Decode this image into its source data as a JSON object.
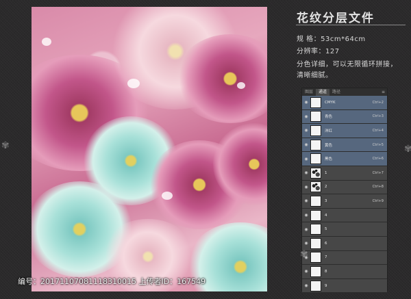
{
  "title": "花纹分层文件",
  "specs": {
    "size": "规 格：53cm*64cm",
    "resolution": "分辨率：127",
    "desc_line1": "分色详细，可以无限循环拼接，",
    "desc_line2": "清晰细腻。"
  },
  "channels_panel": {
    "tabs": [
      "图层",
      "通道",
      "路径"
    ],
    "active_tab": "通道",
    "menu": "≡",
    "rows": [
      {
        "name": "CMYK",
        "key": "Ctrl+2"
      },
      {
        "name": "青色",
        "key": "Ctrl+3"
      },
      {
        "name": "洋红",
        "key": "Ctrl+4"
      },
      {
        "name": "黄色",
        "key": "Ctrl+5"
      },
      {
        "name": "黑色",
        "key": "Ctrl+6"
      },
      {
        "name": "1",
        "key": "Ctrl+7"
      },
      {
        "name": "2",
        "key": "Ctrl+8"
      },
      {
        "name": "3",
        "key": "Ctrl+9"
      },
      {
        "name": "4",
        "key": ""
      },
      {
        "name": "5",
        "key": ""
      },
      {
        "name": "6",
        "key": ""
      },
      {
        "name": "7",
        "key": ""
      },
      {
        "name": "8",
        "key": ""
      },
      {
        "name": "9",
        "key": ""
      }
    ]
  },
  "caption": "编号：20171107081118310015 上传者ID：167549",
  "colors": {
    "selected_row": "#56677e",
    "background": "#2b2a2b"
  }
}
